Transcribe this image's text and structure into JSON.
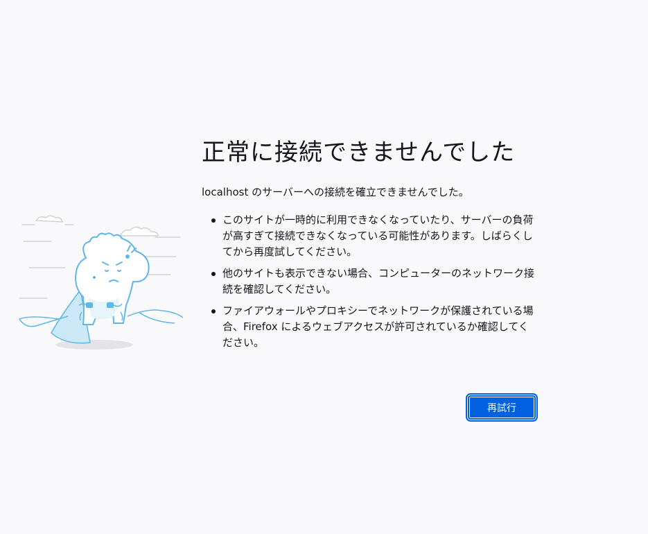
{
  "error": {
    "title": "正常に接続できませんでした",
    "intro": "localhost のサーバーへの接続を確立できませんでした。",
    "reasons": [
      "このサイトが一時的に利用できなくなっていたり、サーバーの負荷が高すぎて接続できなくなっている可能性があります。しばらくしてから再度試してください。",
      "他のサイトも表示できない場合、コンピューターのネットワーク接続を確認してください。",
      "ファイアウォールやプロキシーでネットワークが保護されている場合、Firefox によるウェブアクセスが許可されているか確認してください。"
    ],
    "retry_label": "再試行"
  },
  "colors": {
    "background": "#f9f9fb",
    "text": "#15141a",
    "accent": "#0061e0",
    "illustration_blue": "#5fb7e5",
    "illustration_light": "#cce8f7"
  },
  "illustration": "disconnected-dino-icon"
}
